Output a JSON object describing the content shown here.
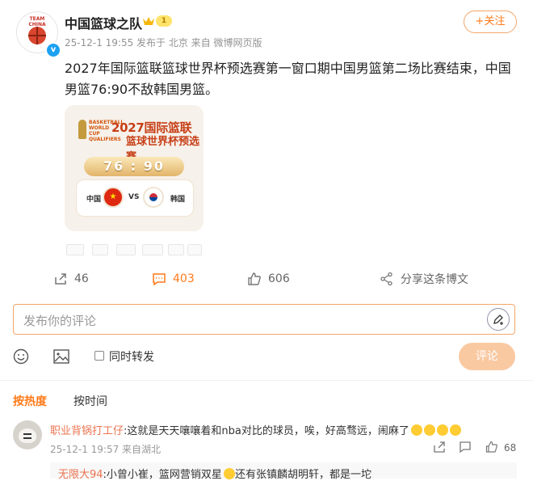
{
  "post": {
    "author": "中国篮球之队",
    "vip_level": "1",
    "avatar_text": "TEAM CHINA",
    "meta": "25-12-1 19:55  发布于 北京  来自 微博网页版",
    "follow_label": "+关注",
    "content": "2027年国际篮联篮球世界杯预选赛第一窗口期中国男篮第二场比赛结束，中国男篮76:90不敌韩国男篮。",
    "image": {
      "logo_text": "BASKETBALL WORLD CUP QUALIFIERS",
      "title_line1": "2027国际篮联",
      "title_line2": "篮球世界杯预选赛",
      "score": "76 : 90",
      "home_team": "中国",
      "vs": "VS",
      "away_team": "韩国"
    }
  },
  "actions": {
    "share_count": "46",
    "comment_count": "403",
    "like_count": "606",
    "share_weibo_label": "分享这条博文"
  },
  "comment_box": {
    "placeholder": "发布你的评论",
    "repost_label": "同时转发",
    "submit_label": "评论"
  },
  "sort_tabs": {
    "hot": "按热度",
    "time": "按时间"
  },
  "comments": [
    {
      "user": "职业背锅打工仔",
      "text": ":这就是天天嚷嚷着和nba对比的球员，唉，好高骛远，闹麻了",
      "meta": "25-12-1 19:57  来自湖北",
      "likes": "68"
    }
  ],
  "reply": {
    "user": "无限大94",
    "text_before": ":小曾小崔，篮网营销双星",
    "text_after": "还有张镇麟胡明轩，都是一坨"
  },
  "colors": {
    "accent": "#ff7a1a",
    "link_user": "#eb7350",
    "submit_disabled": "#f9c9a2"
  }
}
